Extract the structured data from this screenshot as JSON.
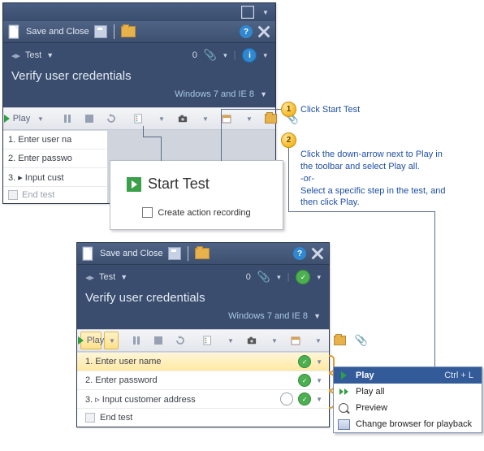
{
  "win1": {
    "ribbon_save": "Save and Close",
    "breadcrumb_test": "Test",
    "count": "0",
    "title": "Verify user credentials",
    "config": "Windows 7 and IE 8",
    "toolbar": {
      "play": "Play"
    },
    "steps": [
      "1. Enter user na",
      "2. Enter passwo",
      "3. ▸ Input cust"
    ],
    "end": "End test"
  },
  "popup": {
    "title": "Start Test",
    "checkbox": "Create action recording"
  },
  "callouts": {
    "n1": "1",
    "t1": "Click Start Test",
    "n2": "2",
    "t2a": "Click the down-arrow next to Play in the toolbar and select Play all.",
    "t2b": "-or-",
    "t2c": "Select a specific step in the test, and then click Play."
  },
  "win2": {
    "ribbon_save": "Save and Close",
    "breadcrumb_test": "Test",
    "count": "0",
    "title": "Verify user credentials",
    "config": "Windows 7 and IE 8",
    "toolbar": {
      "play": "Play"
    },
    "steps": [
      {
        "label": "1. Enter user name",
        "status": "ok",
        "highlight": true
      },
      {
        "label": "2. Enter password",
        "status": "ok",
        "highlight": false
      },
      {
        "label": "3. ▹ Input customer address",
        "status": "idle",
        "highlight": false
      }
    ],
    "end": "End test"
  },
  "menu": {
    "items": [
      {
        "label": "Play",
        "shortcut": "Ctrl + L",
        "sel": true,
        "icon": "play"
      },
      {
        "label": "Play all",
        "shortcut": "",
        "sel": false,
        "icon": "play-all"
      },
      {
        "label": "Preview",
        "shortcut": "",
        "sel": false,
        "icon": "preview"
      },
      {
        "label": "Change browser for playback",
        "shortcut": "",
        "sel": false,
        "icon": "browser"
      }
    ]
  }
}
